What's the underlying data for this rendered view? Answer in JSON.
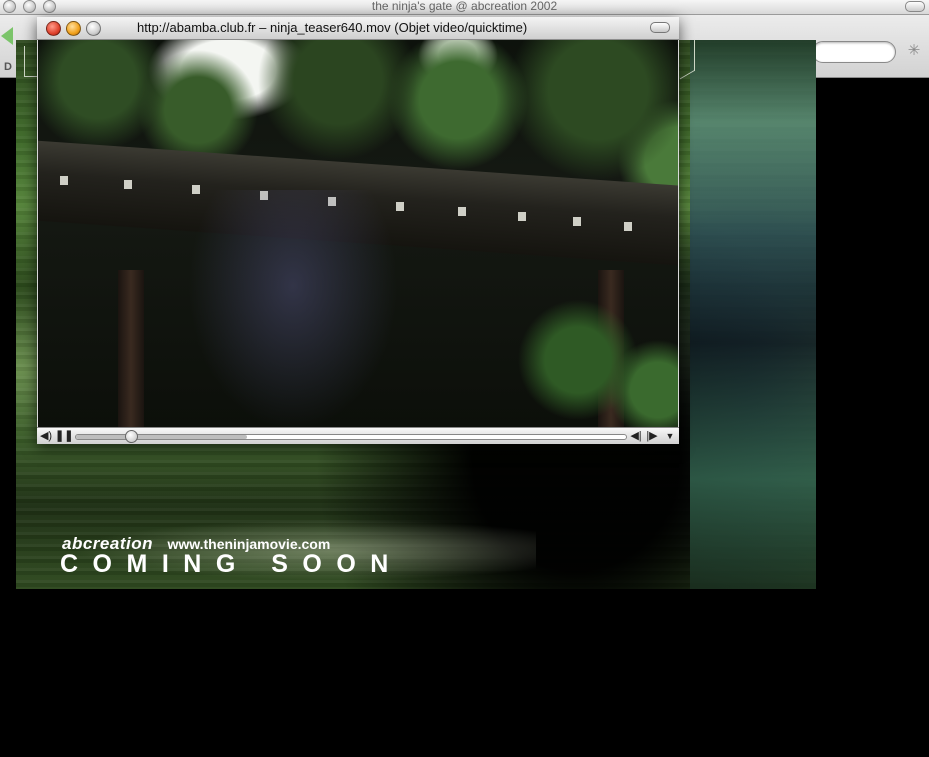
{
  "browser": {
    "window_title": "the ninja's gate @ abcreation 2002",
    "toolbar_left_glyph": "D"
  },
  "player": {
    "window_title": "http://abamba.club.fr – ninja_teaser640.mov (Objet video/quicktime)",
    "controls": {
      "volume_icon": "speaker-icon",
      "play_pause_icon": "pause-icon",
      "step_back_icon": "step-back-icon",
      "step_forward_icon": "step-forward-icon",
      "menu_icon": "disclosure-triangle-icon",
      "playhead_fraction": 0.1,
      "loaded_fraction": 0.31
    }
  },
  "page": {
    "brand": "abcreation",
    "url": "www.theninjamovie.com",
    "tagline": "COMING SOON"
  },
  "colors": {
    "close_button": "#e0432e",
    "minimize_button": "#f1a11b",
    "back_arrow": "#7bc46a"
  }
}
